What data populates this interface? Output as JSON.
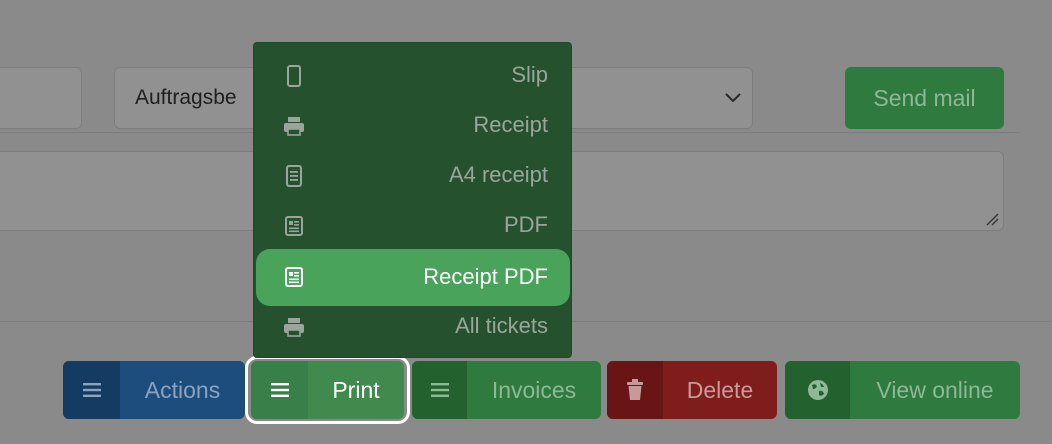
{
  "form": {
    "select_value": "Auftragsbe"
  },
  "header": {
    "send_mail_label": "Send mail"
  },
  "print_menu": {
    "items": [
      {
        "label": "Slip",
        "icon": "phone-icon"
      },
      {
        "label": "Receipt",
        "icon": "printer-icon"
      },
      {
        "label": "A4 receipt",
        "icon": "document-icon"
      },
      {
        "label": "PDF",
        "icon": "document-lines-icon"
      },
      {
        "label": "Receipt PDF",
        "icon": "document-lines-icon",
        "active": true
      },
      {
        "label": "All tickets",
        "icon": "printer-icon"
      }
    ]
  },
  "toolbar": {
    "actions_label": "Actions",
    "print_label": "Print",
    "invoices_label": "Invoices",
    "delete_label": "Delete",
    "view_online_label": "View online"
  },
  "colors": {
    "overlay_gray": "#8a8a8a",
    "primary_blue": "#1c4d7d",
    "success_green": "#2e7a3f",
    "danger_red": "#7f1d1d",
    "menu_bg": "#25512e",
    "menu_active": "#4aa35b"
  }
}
